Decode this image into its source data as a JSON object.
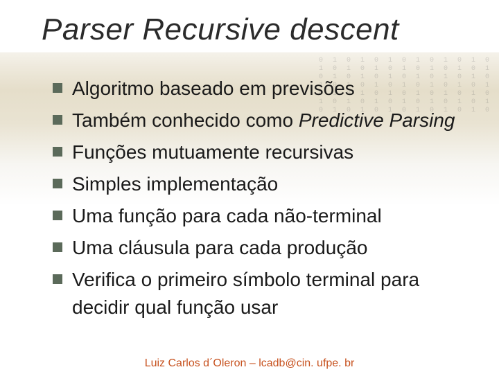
{
  "title": "Parser Recursive descent",
  "bullets": [
    {
      "plain": "Algoritmo baseado em previsões",
      "italic": ""
    },
    {
      "plain": "Também conhecido como ",
      "italic": "Predictive Parsing"
    },
    {
      "plain": "Funções mutuamente recursivas",
      "italic": ""
    },
    {
      "plain": "Simples implementação",
      "italic": ""
    },
    {
      "plain": "Uma função para cada não-terminal",
      "italic": ""
    },
    {
      "plain": "Uma cláusula para cada produção",
      "italic": ""
    },
    {
      "plain": "Verifica o primeiro símbolo terminal para decidir qual função usar",
      "italic": ""
    }
  ],
  "footer": "Luiz Carlos d´Oleron – lcadb@cin. ufpe. br",
  "deco": "0 1 0 1 0 1 0 1 0 1 0 1 0 1 0 1 0 1\n1 0 1 0 1 0 1 0 1 0 1 0 1 0 1 0 1 0\n0 1 0 1 0 1 0 1 0 1 0 1 0 1 0 1 0 1\n1 0 1 0 1 0 1 0 1 0 1 0 1 0 1 0 1 0\n0 1 0 1 0 1 0 1 0 1 0 1 0 1 0 1 0 1\n1 0 1 0 1 0 1 0 1 0 1 0 1 0 1 0 1 0\n0 1 0 1 0 1 0 1 0 1 0 1 0 1 0 1 0 1"
}
